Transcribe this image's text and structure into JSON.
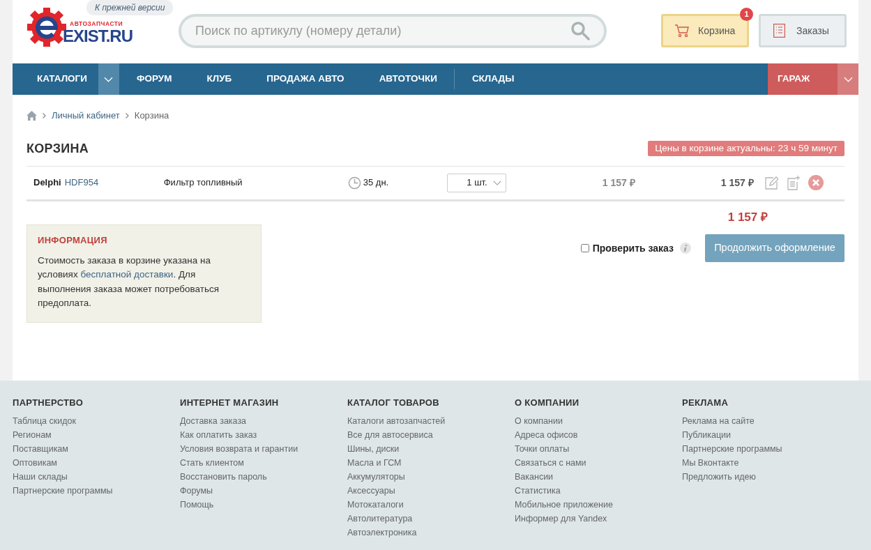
{
  "header": {
    "old_version_link": "К прежней версии",
    "logo": {
      "tagline": "АВТОЗАПЧАСТИ",
      "name": "EXIST.RU"
    },
    "search": {
      "placeholder": "Поиск по артикулу (номеру детали)"
    },
    "cart_button": {
      "label": "Корзина",
      "badge": "1"
    },
    "orders_button": {
      "label": "Заказы"
    }
  },
  "nav": {
    "items": [
      {
        "label": "КАТАЛОГИ",
        "dropdown": true,
        "divider_after": false
      },
      {
        "label": "ФОРУМ",
        "dropdown": false,
        "divider_after": false
      },
      {
        "label": "КЛУБ",
        "dropdown": false,
        "divider_after": false
      },
      {
        "label": "ПРОДАЖА АВТО",
        "dropdown": false,
        "divider_after": false
      },
      {
        "label": "АВТОТОЧКИ",
        "dropdown": false,
        "divider_after": true
      },
      {
        "label": "СКЛАДЫ",
        "dropdown": false,
        "divider_after": false
      }
    ],
    "garage": "ГАРАЖ"
  },
  "breadcrumbs": [
    "Личный кабинет",
    "Корзина"
  ],
  "page_title": "КОРЗИНА",
  "price_notice": "Цены в корзине актуальны: 23 ч 59 минут",
  "cart_rows": [
    {
      "brand": "Delphi",
      "article": "HDF954",
      "name": "Фильтр топливный",
      "delivery": "35 дн.",
      "quantity": "1 шт.",
      "price": "1 157 ₽",
      "sum": "1 157 ₽"
    }
  ],
  "total": "1 157 ₽",
  "info": {
    "title": "ИНФОРМАЦИЯ",
    "text_before": "Стоимость заказа в корзине указана на условиях ",
    "link": "бесплатной доставки",
    "text_after": ". Для выполнения заказа может потребоваться предоплата."
  },
  "check_order": {
    "label": "Проверить заказ",
    "checked": false
  },
  "continue_button": "Продолжить оформление",
  "footer": [
    {
      "title": "ПАРТНЕРСТВО",
      "links": [
        "Таблица скидок",
        "Регионам",
        "Поставщикам",
        "Оптовикам",
        "Наши склады",
        "Партнерские программы"
      ]
    },
    {
      "title": "ИНТЕРНЕТ МАГАЗИН",
      "links": [
        "Доставка заказа",
        "Как оплатить заказ",
        "Условия возврата и гарантии",
        "Стать клиентом",
        "Восстановить пароль",
        "Форумы",
        "Помощь"
      ]
    },
    {
      "title": "КАТАЛОГ ТОВАРОВ",
      "links": [
        "Каталоги автозапчастей",
        "Все для автосервиса",
        "Шины, диски",
        "Масла и ГСМ",
        "Аккумуляторы",
        "Аксессуары",
        "Мотокаталоги",
        "Автолитература",
        "Автоэлектроника"
      ]
    },
    {
      "title": "О КОМПАНИИ",
      "links": [
        "О компании",
        "Адреса офисов",
        "Точки оплаты",
        "Связаться с нами",
        "Вакансии",
        "Статистика",
        "Мобильное приложение",
        "Информер для Yandex"
      ]
    },
    {
      "title": "РЕКЛАМА",
      "links": [
        "Реклама на сайте",
        "Публикации",
        "Партнерские программы",
        "Мы Вконтакте",
        "Предложить идею"
      ]
    }
  ]
}
